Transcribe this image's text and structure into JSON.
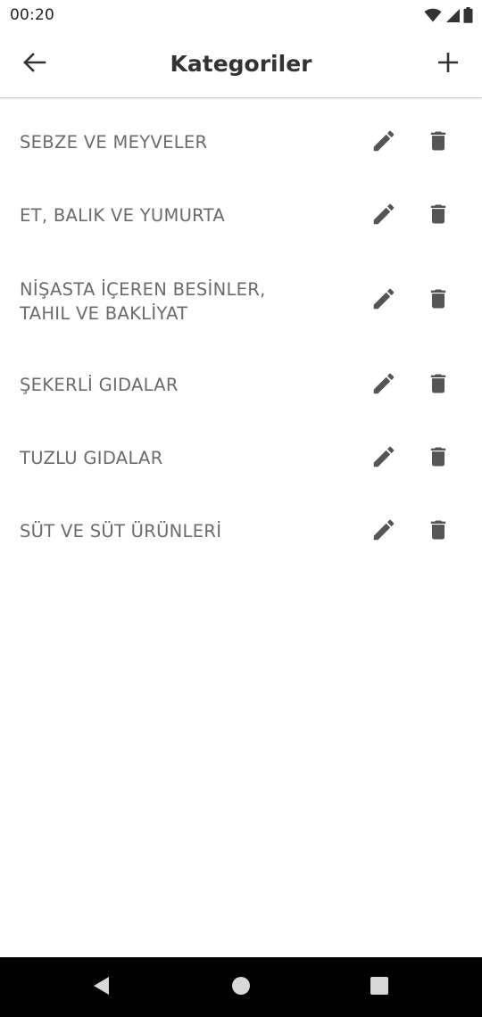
{
  "status_bar": {
    "time": "00:20",
    "icons": [
      "wifi-icon",
      "signal-icon",
      "battery-icon"
    ]
  },
  "app_bar": {
    "title": "Kategoriler",
    "back_icon": "arrow-left-icon",
    "add_icon": "plus-icon"
  },
  "categories": [
    {
      "line1": "SEBZE VE MEYVELER",
      "line2": ""
    },
    {
      "line1": "ET, BALIK VE YUMURTA",
      "line2": ""
    },
    {
      "line1": "NİŞASTA İÇEREN BESİNLER,",
      "line2": "TAHIL VE BAKLİYAT"
    },
    {
      "line1": "ŞEKERLİ GIDALAR",
      "line2": ""
    },
    {
      "line1": "TUZLU GIDALAR",
      "line2": ""
    },
    {
      "line1": "SÜT VE SÜT ÜRÜNLERİ",
      "line2": ""
    }
  ],
  "row_actions": {
    "edit_icon": "pencil-icon",
    "delete_icon": "trash-icon"
  },
  "nav_bar": {
    "icons": [
      "nav-back-icon",
      "nav-home-icon",
      "nav-recents-icon"
    ]
  },
  "colors": {
    "text_primary": "#333333",
    "text_secondary": "#6b6b6b",
    "icon": "#555555",
    "nav_background": "#000000"
  }
}
